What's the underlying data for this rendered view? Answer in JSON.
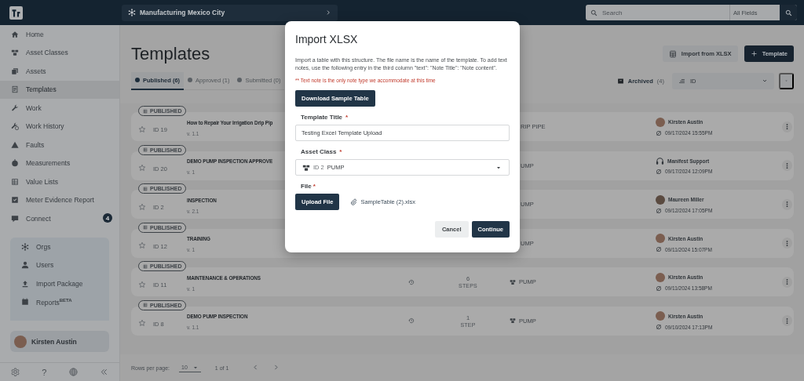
{
  "top_bar": {
    "location": "Manufacturing Mexico City",
    "search": {
      "placeholder": "Search",
      "scope": "All Fields"
    }
  },
  "sidebar": {
    "items": [
      {
        "label": "Home",
        "selected": false
      },
      {
        "label": "Asset Classes",
        "selected": false
      },
      {
        "label": "Assets",
        "selected": false
      },
      {
        "label": "Templates",
        "selected": true
      },
      {
        "label": "Work",
        "selected": false
      },
      {
        "label": "Work History",
        "selected": false
      },
      {
        "label": "Faults",
        "selected": false
      },
      {
        "label": "Measurements",
        "selected": false
      },
      {
        "label": "Value Lists",
        "selected": false
      },
      {
        "label": "Meter Evidence Report",
        "selected": false
      },
      {
        "label": "Connect",
        "selected": false,
        "badge": "4"
      }
    ],
    "admin_items": [
      {
        "label": "Orgs"
      },
      {
        "label": "Users"
      },
      {
        "label": "Import Package"
      },
      {
        "label": "Reports$^{BETA}$"
      }
    ],
    "user": {
      "name": "Kirsten Austin"
    },
    "footer": {
      "help": "?"
    }
  },
  "page": {
    "title": "Templates",
    "import_button": "Import from XLSX",
    "add_button": "Template",
    "tabs": [
      {
        "label": "Published (6)",
        "selected": true
      },
      {
        "label": "Approved (1)",
        "selected": false
      },
      {
        "label": "Submitted (0)",
        "selected": false
      }
    ],
    "archived": {
      "label": "Archived",
      "count": "(4)"
    },
    "sort": {
      "value": "ID"
    },
    "rows": [
      {
        "status": "PUBLISHED",
        "starred": false,
        "id": "ID 19",
        "title": "How to Repair Your Irrigation Drip Pip",
        "version": "v. 1.1",
        "asset_icon": false,
        "asset_class": "RIP PIPE",
        "user": {
          "kind": "person",
          "name": "Kirsten Austin",
          "date": "09/17/2024 15:55PM"
        }
      },
      {
        "status": "PUBLISHED",
        "starred": false,
        "id": "ID 20",
        "title": "DEMO PUMP INSPECTION APPROVE",
        "version": "v. 1",
        "asset_icon": false,
        "asset_class": "UMP",
        "user": {
          "kind": "support",
          "name": "Manifest Support",
          "date": "09/17/2024 12:09PM"
        }
      },
      {
        "status": "PUBLISHED",
        "starred": false,
        "id": "ID 2",
        "title": "INSPECTION",
        "version": "v. 2.1",
        "asset_icon": false,
        "asset_class": "UMP",
        "user": {
          "kind": "person",
          "name": "Maureen Miller",
          "date": "09/12/2024 17:05PM"
        }
      },
      {
        "status": "PUBLISHED",
        "starred": false,
        "id": "ID 12",
        "title": "TRAINING",
        "version": "v. 1",
        "asset_icon": false,
        "asset_class": "UMP",
        "user": {
          "kind": "person",
          "name": "Kirsten Austin",
          "date": "09/11/2024 15:07PM"
        }
      },
      {
        "status": "PUBLISHED",
        "starred": false,
        "id": "ID 11",
        "title": "MAINTENANCE & OPERATIONS",
        "version": "v. 1",
        "steps": {
          "count": "6",
          "label": "STEPS"
        },
        "asset_icon": true,
        "asset_class": "PUMP",
        "user": {
          "kind": "person",
          "name": "Kirsten Austin",
          "date": "09/11/2024 13:58PM"
        }
      },
      {
        "status": "PUBLISHED",
        "starred": false,
        "id": "ID 8",
        "title": "DEMO PUMP INSPECTION",
        "version": "v. 1.1",
        "steps": {
          "count": "1",
          "label": "STEP"
        },
        "asset_icon": true,
        "asset_class": "PUMP",
        "user": {
          "kind": "person",
          "name": "Kirsten Austin",
          "date": "09/10/2024 17:13PM"
        }
      }
    ],
    "pagination": {
      "label": "Rows per page:",
      "rows_per_page": "10",
      "range": "1 of 1"
    }
  },
  "dialog": {
    "title": "Import XLSX",
    "description": "Import a table with this structure. The file name is the name of the template. To add text notes, use the following entry in the third column \"text\": \"Note Title\": \"Note content\".",
    "note": "** Text note is the only note type we accommodate at this time",
    "download_button": "Download Sample Table",
    "template_title": {
      "label": "Template Title",
      "required": "*",
      "value": "Testing Excel Template Upload"
    },
    "asset_class": {
      "label": "Asset Class",
      "required": "*",
      "id": "ID 2",
      "value": "PUMP"
    },
    "file": {
      "label": "File",
      "required": "*",
      "button": "Upload File",
      "filename": "SampleTable (2).xlsx"
    },
    "cancel_button": "Cancel",
    "continue_button": "Continue"
  }
}
